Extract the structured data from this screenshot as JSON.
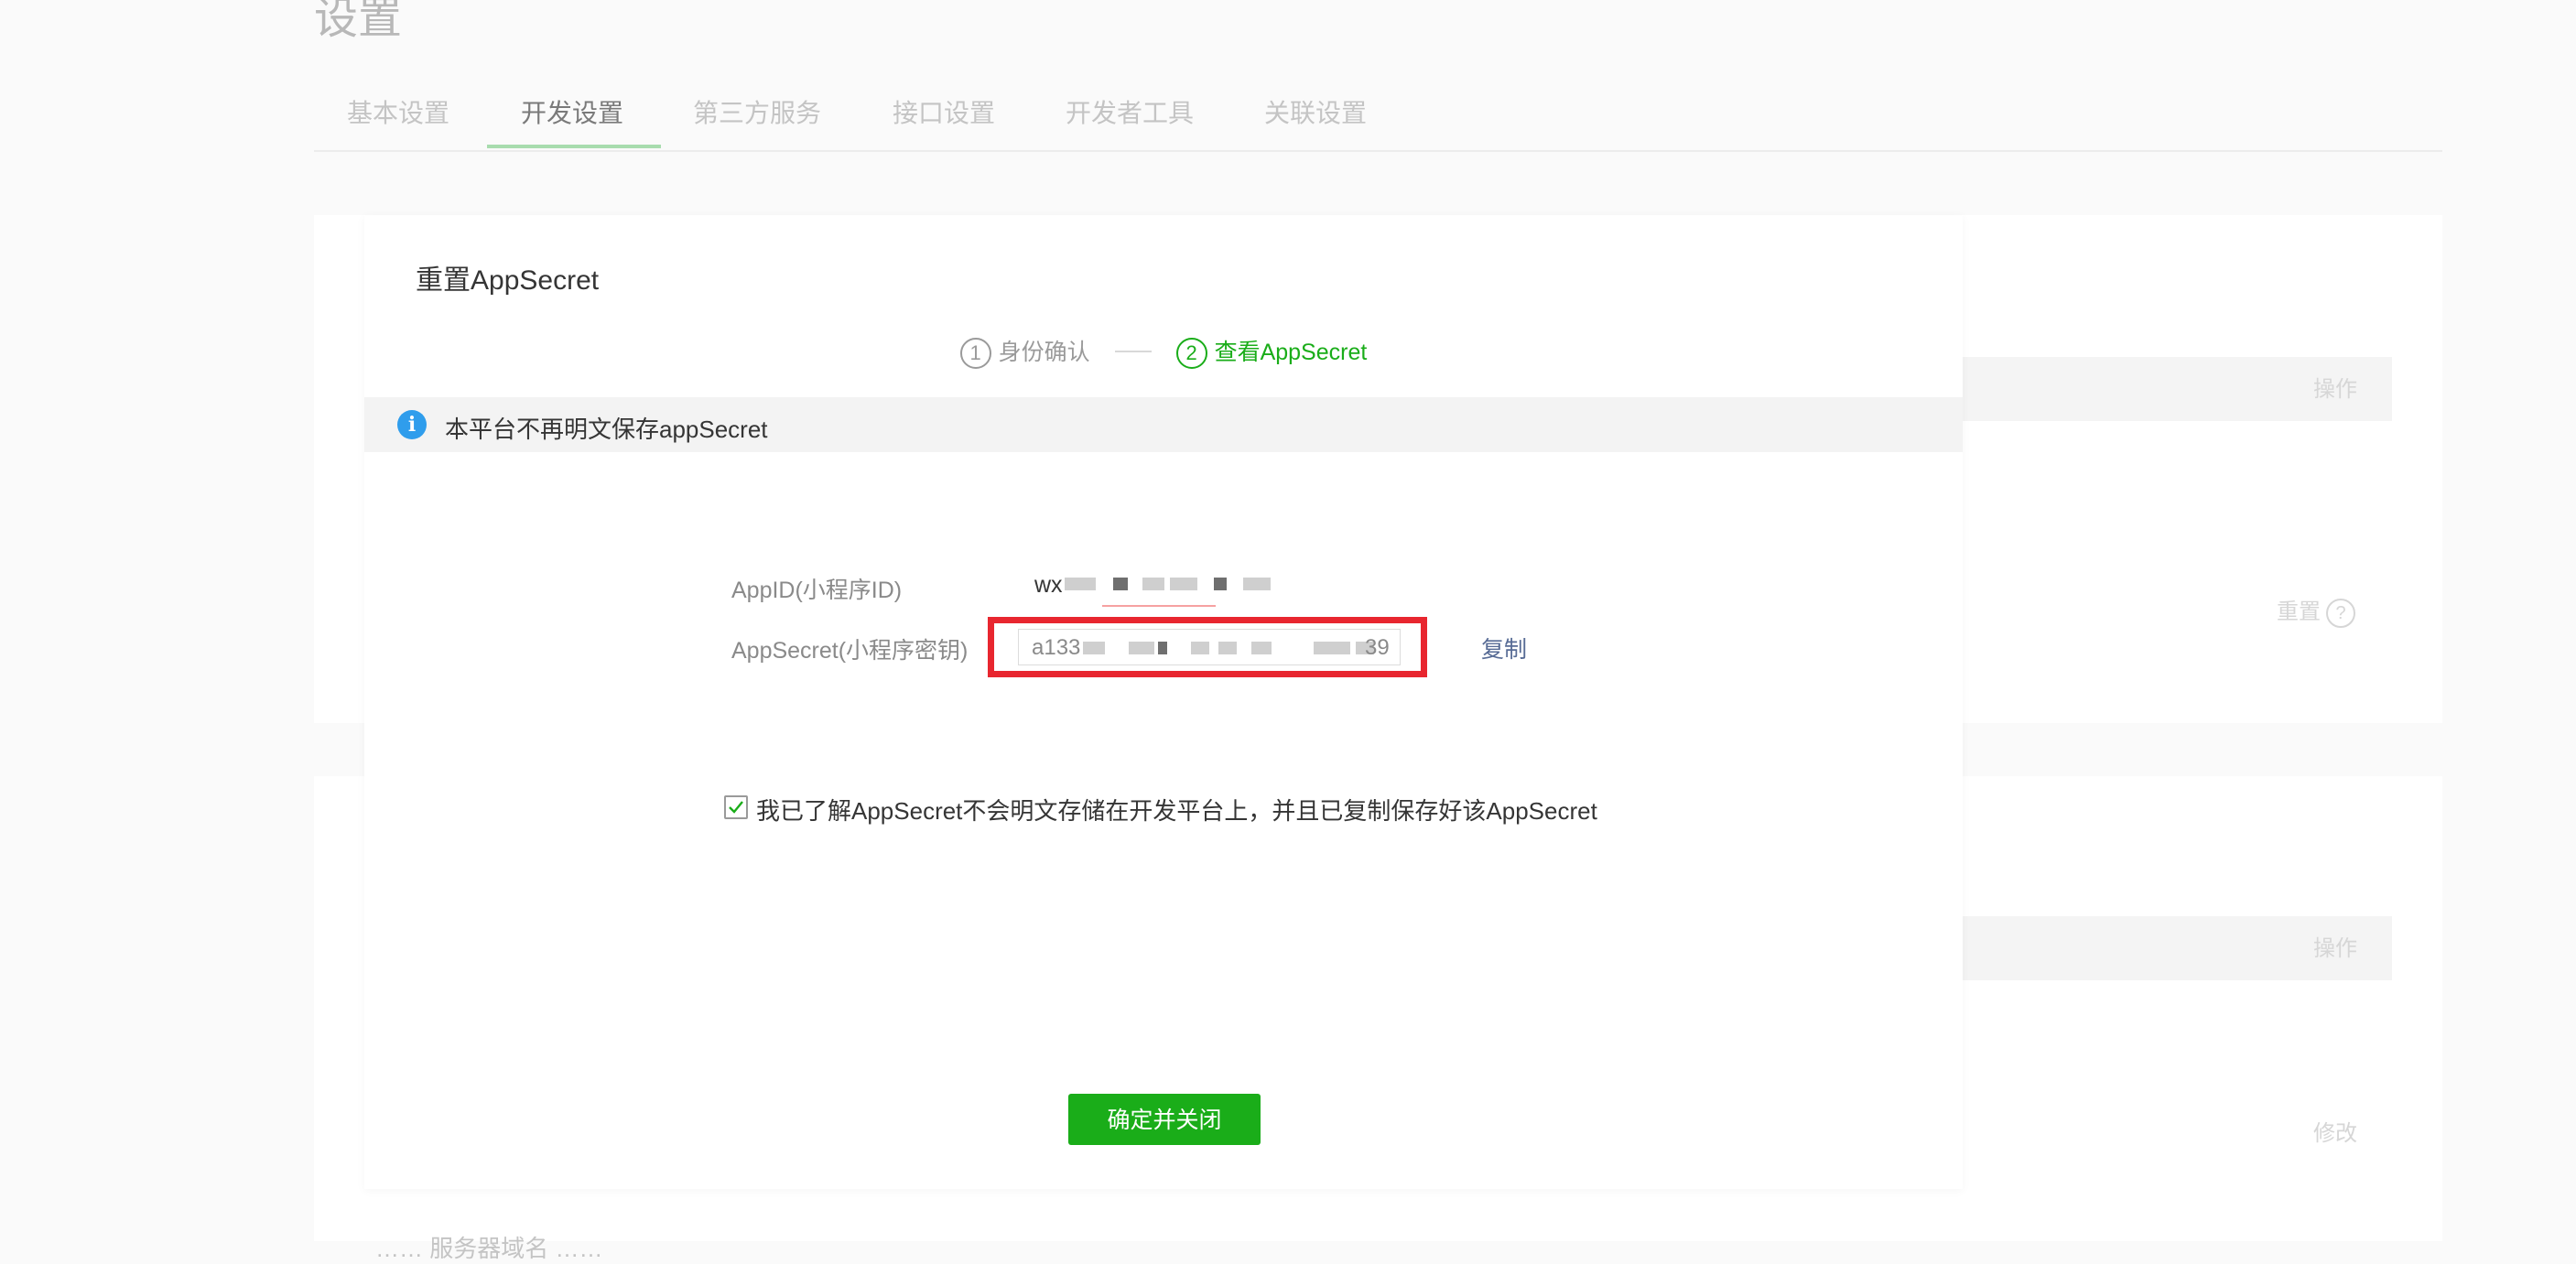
{
  "page": {
    "title": "设置"
  },
  "tabs": [
    {
      "label": "基本设置"
    },
    {
      "label": "开发设置"
    },
    {
      "label": "第三方服务"
    },
    {
      "label": "接口设置"
    },
    {
      "label": "开发者工具"
    },
    {
      "label": "关联设置"
    }
  ],
  "background": {
    "op_header_1": "操作",
    "reset_link": "重置",
    "op_header_2": "操作",
    "modify_link": "修改",
    "footnote": "…… 服务器域名 ……"
  },
  "dialog": {
    "title": "重置AppSecret",
    "steps": [
      {
        "num": "1",
        "label": "身份确认",
        "state": "done"
      },
      {
        "num": "2",
        "label": "查看AppSecret",
        "state": "active"
      }
    ],
    "notice": {
      "icon": "info-icon",
      "text": "本平台不再明文保存appSecret"
    },
    "appid": {
      "label": "AppID(小程序ID)",
      "value_prefix": "wx"
    },
    "appsecret": {
      "label": "AppSecret(小程序密钥)",
      "value_prefix": "a133",
      "value_suffix": "39",
      "copy_label": "复制",
      "highlight_color": "#e8262f"
    },
    "acknowledge": {
      "checked": true,
      "label": "我已了解AppSecret不会明文存储在开发平台上，并且已复制保存好该AppSecret"
    },
    "confirm_button": "确定并关闭"
  },
  "colors": {
    "primary_green": "#1aad19",
    "link_blue": "#576b95",
    "info_blue": "#2f9dec"
  }
}
